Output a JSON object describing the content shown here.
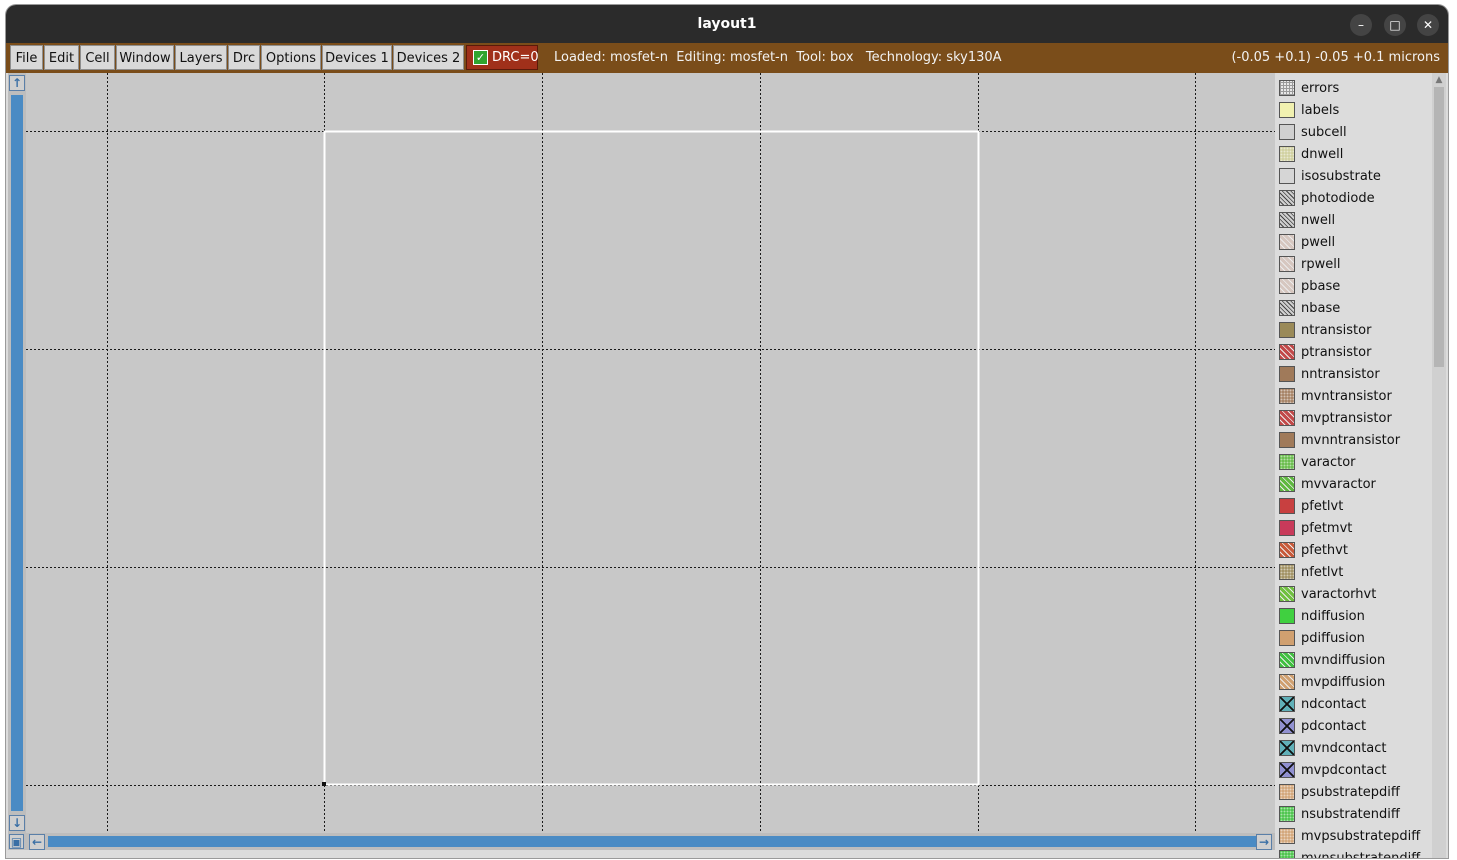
{
  "window": {
    "title": "layout1",
    "minimize_glyph": "–",
    "maximize_glyph": "□",
    "close_glyph": "✕"
  },
  "menu": [
    "File",
    "Edit",
    "Cell",
    "Window",
    "Layers",
    "Drc",
    "Options",
    "Devices 1",
    "Devices 2"
  ],
  "drc": {
    "label": "DRC=0",
    "checked": true
  },
  "status": {
    "text": "Loaded: mosfet-n  Editing: mosfet-n  Tool: box   Technology: sky130A",
    "coords": "(-0.05 +0.1) -0.05 +0.1 microns"
  },
  "colors": {
    "menubar": "#7a4d1a",
    "canvas": "#c8c8c8",
    "scroll_accent": "#4a8bc4",
    "box_outline": "#ffffff"
  },
  "layers": [
    {
      "name": "errors",
      "color": "#e8e8e8",
      "pattern": "grid"
    },
    {
      "name": "labels",
      "color": "#f1f1b0",
      "pattern": "solid"
    },
    {
      "name": "subcell",
      "color": "#d0d0d0",
      "pattern": "solid"
    },
    {
      "name": "dnwell",
      "color": "#cdcd99",
      "pattern": "dots"
    },
    {
      "name": "isosubstrate",
      "color": "#d6d6d6",
      "pattern": "solid"
    },
    {
      "name": "photodiode",
      "color": "#cfcfcf",
      "pattern": "diag-dark"
    },
    {
      "name": "nwell",
      "color": "#cfcfcf",
      "pattern": "diag-dark"
    },
    {
      "name": "pwell",
      "color": "#d6c7c0",
      "pattern": "diag"
    },
    {
      "name": "rpwell",
      "color": "#d6c7c0",
      "pattern": "diag"
    },
    {
      "name": "pbase",
      "color": "#d6c7c0",
      "pattern": "diag"
    },
    {
      "name": "nbase",
      "color": "#cfcfcf",
      "pattern": "diag-dark"
    },
    {
      "name": "ntransistor",
      "color": "#9a8a58",
      "pattern": "solid"
    },
    {
      "name": "ptransistor",
      "color": "#c24848",
      "pattern": "diag"
    },
    {
      "name": "nntransistor",
      "color": "#a07a5a",
      "pattern": "solid"
    },
    {
      "name": "mvntransistor",
      "color": "#a07a5a",
      "pattern": "dots"
    },
    {
      "name": "mvptransistor",
      "color": "#c24848",
      "pattern": "diag"
    },
    {
      "name": "mvnntransistor",
      "color": "#a07a5a",
      "pattern": "solid"
    },
    {
      "name": "varactor",
      "color": "#5fb840",
      "pattern": "dots"
    },
    {
      "name": "mvvaractor",
      "color": "#5fb840",
      "pattern": "diag"
    },
    {
      "name": "pfetlvt",
      "color": "#c84040",
      "pattern": "solid"
    },
    {
      "name": "pfetmvt",
      "color": "#c83a5a",
      "pattern": "solid"
    },
    {
      "name": "pfethvt",
      "color": "#c85a3a",
      "pattern": "diag"
    },
    {
      "name": "nfetlvt",
      "color": "#9a8a58",
      "pattern": "dots"
    },
    {
      "name": "varactorhvt",
      "color": "#70c040",
      "pattern": "diag"
    },
    {
      "name": "ndiffusion",
      "color": "#40d040",
      "pattern": "solid"
    },
    {
      "name": "pdiffusion",
      "color": "#d0a070",
      "pattern": "solid"
    },
    {
      "name": "mvndiffusion",
      "color": "#40c040",
      "pattern": "diag"
    },
    {
      "name": "mvpdiffusion",
      "color": "#d0a070",
      "pattern": "diag"
    },
    {
      "name": "ndcontact",
      "color": "#60b0b8",
      "pattern": "cross"
    },
    {
      "name": "pdcontact",
      "color": "#9090d0",
      "pattern": "cross"
    },
    {
      "name": "mvndcontact",
      "color": "#60b0b8",
      "pattern": "cross"
    },
    {
      "name": "mvpdcontact",
      "color": "#9090d0",
      "pattern": "cross"
    },
    {
      "name": "psubstratepdiff",
      "color": "#d0a070",
      "pattern": "dots"
    },
    {
      "name": "nsubstratendiff",
      "color": "#40c040",
      "pattern": "dots"
    },
    {
      "name": "mvpsubstratepdiff",
      "color": "#d0a070",
      "pattern": "dots"
    },
    {
      "name": "mvnsubstratendiff",
      "color": "#40c040",
      "pattern": "dots"
    }
  ]
}
